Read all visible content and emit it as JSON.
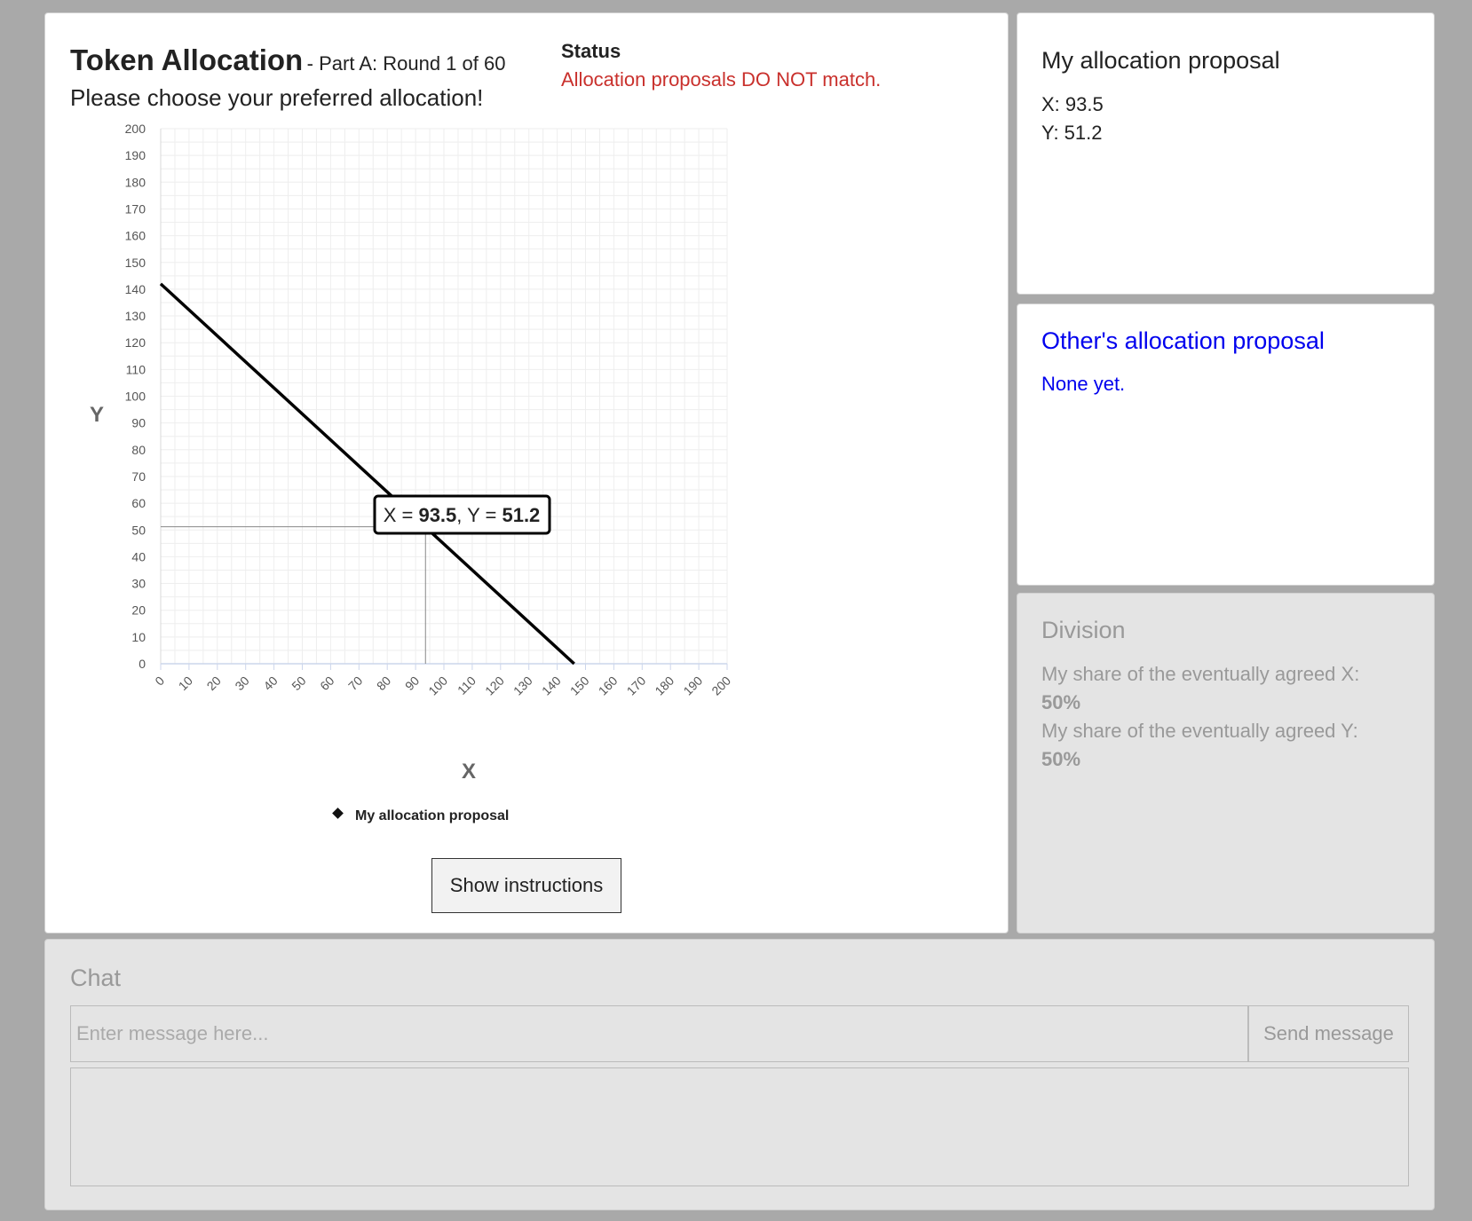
{
  "header": {
    "title": "Token Allocation",
    "subtitle": "- Part A: Round 1 of 60",
    "prompt": "Please choose your preferred allocation!"
  },
  "status": {
    "label": "Status",
    "text": "Allocation proposals DO NOT match.",
    "text_color": "#c9302c"
  },
  "chart_data": {
    "type": "line",
    "xlabel": "X",
    "ylabel": "Y",
    "xlim": [
      0,
      200
    ],
    "ylim": [
      0,
      200
    ],
    "x_ticks": [
      "0",
      "10",
      "20",
      "30",
      "40",
      "50",
      "60",
      "70",
      "80",
      "90",
      "100",
      "110",
      "120",
      "130",
      "140",
      "150",
      "160",
      "170",
      "180",
      "190",
      "200"
    ],
    "y_ticks": [
      "0",
      "10",
      "20",
      "30",
      "40",
      "50",
      "60",
      "70",
      "80",
      "90",
      "100",
      "110",
      "120",
      "130",
      "140",
      "150",
      "160",
      "170",
      "180",
      "190",
      "200"
    ],
    "grid": true,
    "budget_line": {
      "x": [
        0,
        146
      ],
      "y": [
        142,
        0
      ]
    },
    "selected_point": {
      "x": 93.5,
      "y": 51.2
    },
    "tooltip": {
      "prefix_x": "X = ",
      "x": "93.5",
      "sep": ", Y = ",
      "y": "51.2"
    },
    "legend": {
      "label": "My allocation proposal",
      "placement": "bottom-center"
    }
  },
  "buttons": {
    "show_instructions": "Show instructions",
    "send_message": "Send message"
  },
  "my_proposal": {
    "heading": "My allocation proposal",
    "x_line": "X: 93.5",
    "y_line": "Y: 51.2"
  },
  "other_proposal": {
    "heading": "Other's allocation proposal",
    "text": "None yet.",
    "color": "#0000ee"
  },
  "division": {
    "heading": "Division",
    "x_label": "My share of the eventually agreed X:",
    "x_value": "50%",
    "y_label": "My share of the eventually agreed Y:",
    "y_value": "50%"
  },
  "chat": {
    "heading": "Chat",
    "placeholder": "Enter message here..."
  }
}
